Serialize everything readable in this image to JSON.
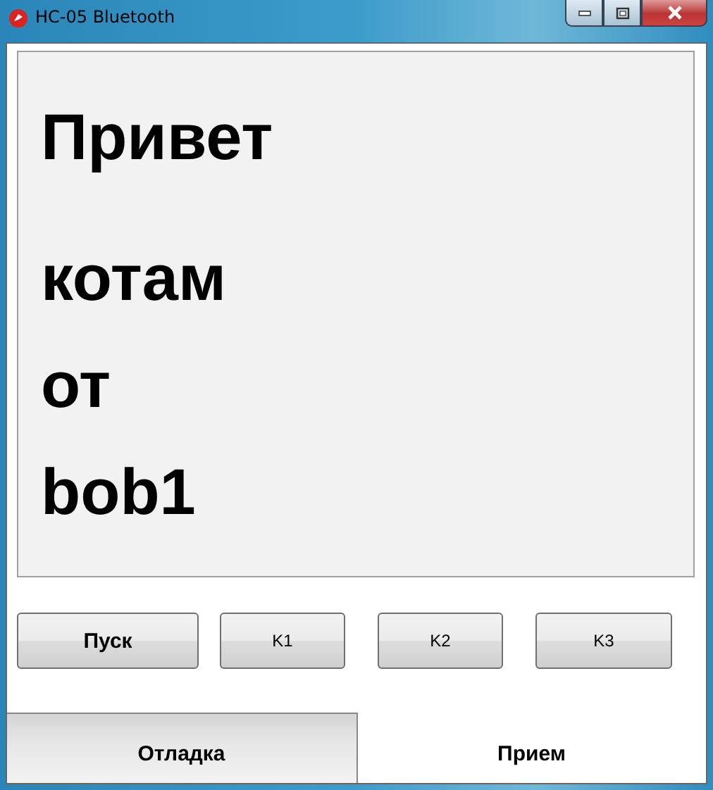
{
  "window": {
    "title": "HC-05 Bluetooth"
  },
  "display": {
    "lines": [
      "Привет",
      "котам",
      "от",
      "bob1"
    ]
  },
  "buttons": [
    {
      "label": "Пуск",
      "kind": "primary"
    },
    {
      "label": "K1",
      "kind": "plain"
    },
    {
      "label": "K2",
      "kind": "plain"
    },
    {
      "label": "K3",
      "kind": "plain"
    }
  ],
  "tabs": [
    {
      "label": "Отладка",
      "selected": false
    },
    {
      "label": "Прием",
      "selected": true
    }
  ]
}
